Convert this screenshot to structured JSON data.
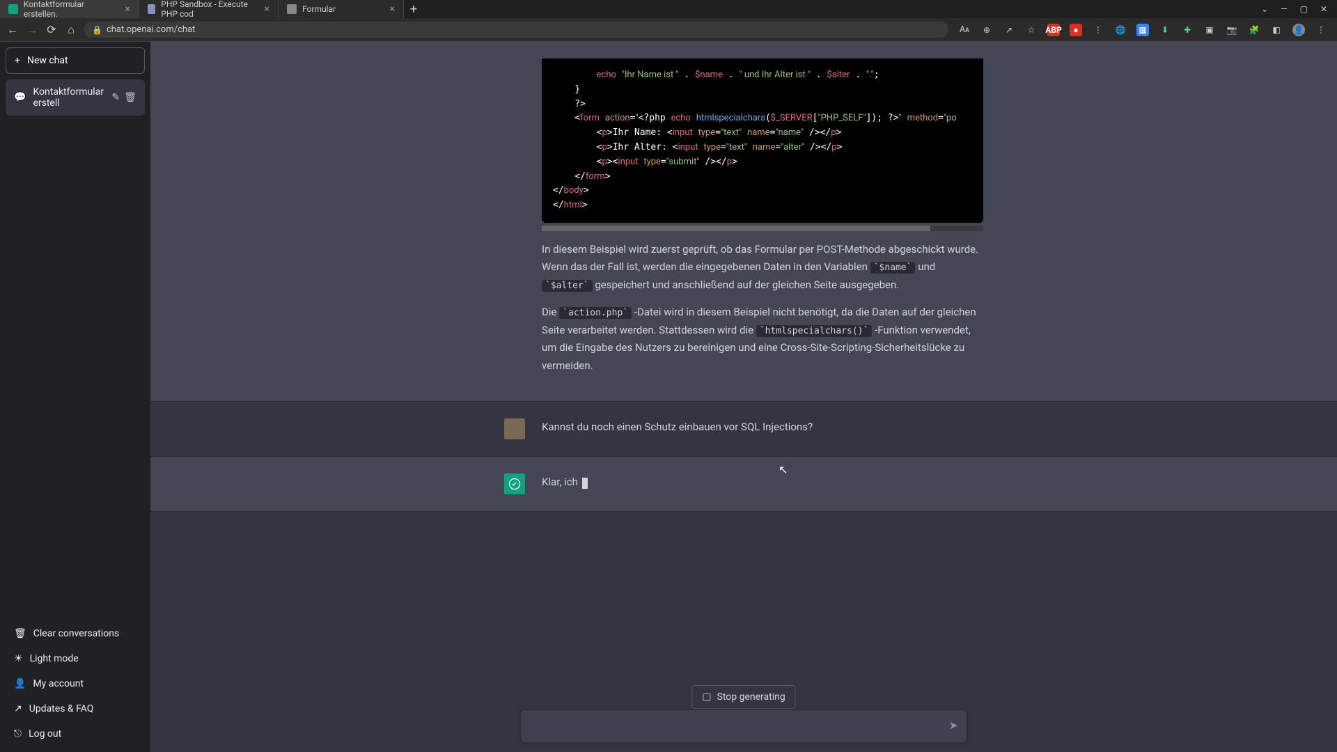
{
  "browser": {
    "tabs": [
      {
        "title": "Kontaktformular erstellen.",
        "active": true,
        "favicon_color": "#10a37f"
      },
      {
        "title": "PHP Sandbox - Execute PHP cod",
        "active": false,
        "favicon_color": "#8892bf"
      },
      {
        "title": "Formular",
        "active": false,
        "favicon_color": "#888"
      }
    ],
    "url": "chat.openai.com/chat",
    "window_controls": {
      "chevron": "⌄",
      "min": "—",
      "max": "▢",
      "close": "✕"
    }
  },
  "sidebar": {
    "new_chat_label": "New chat",
    "conversations": [
      {
        "title": "Kontaktformular erstell"
      }
    ],
    "bottom_items": [
      {
        "icon": "trash",
        "label": "Clear conversations"
      },
      {
        "icon": "sun",
        "label": "Light mode"
      },
      {
        "icon": "user",
        "label": "My account"
      },
      {
        "icon": "link",
        "label": "Updates & FAQ"
      },
      {
        "icon": "logout",
        "label": "Log out"
      }
    ]
  },
  "chat": {
    "assistant_code": {
      "lines_html": "        <span class='t-key'>echo</span> <span class='t-str'>\"Ihr Name ist \"</span> . <span class='t-var'>$name</span> . <span class='t-str'>\" und Ihr Alter ist \"</span> . <span class='t-var'>$alter</span> . <span class='t-str'>\".\"</span>;\n    }\n    ?&gt;\n    &lt;<span class='t-key'>form</span> <span class='t-attr'>action</span>=<span class='t-str'>\"</span>&lt;?php <span class='t-key'>echo</span> <span class='t-fn'>htmlspecialchars</span>(<span class='t-var'>$_SERVER</span>[<span class='t-str'>\"PHP_SELF\"</span>]); ?&gt;<span class='t-str'>\"</span> <span class='t-attr'>method</span>=<span class='t-str'>\"po</span>\n        &lt;<span class='t-key'>p</span>&gt;Ihr Name: &lt;<span class='t-key'>input</span> <span class='t-attr'>type</span>=<span class='t-type'>\"text\"</span> <span class='t-attr'>name</span>=<span class='t-type'>\"name\"</span> /&gt;&lt;/<span class='t-key'>p</span>&gt;\n        &lt;<span class='t-key'>p</span>&gt;Ihr Alter: &lt;<span class='t-key'>input</span> <span class='t-attr'>type</span>=<span class='t-type'>\"text\"</span> <span class='t-attr'>name</span>=<span class='t-type'>\"alter\"</span> /&gt;&lt;/<span class='t-key'>p</span>&gt;\n        &lt;<span class='t-key'>p</span>&gt;&lt;<span class='t-key'>input</span> <span class='t-attr'>type</span>=<span class='t-type'>\"submit\"</span> /&gt;&lt;/<span class='t-key'>p</span>&gt;\n    &lt;/<span class='t-key'>form</span>&gt;\n&lt;/<span class='t-key'>body</span>&gt;\n&lt;/<span class='t-key'>html</span>&gt;"
    },
    "assistant_text": {
      "p1_a": "In diesem Beispiel wird zuerst geprüft, ob das Formular per POST-Methode abgeschickt wurde. Wenn das der Fall ist, werden die eingegebenen Daten in den Variablen ",
      "p1_code1": "`$name`",
      "p1_b": " und ",
      "p1_code2": "`$alter`",
      "p1_c": " gespeichert und anschließend auf der gleichen Seite ausgegeben.",
      "p2_a": "Die ",
      "p2_code1": "`action.php`",
      "p2_b": "-Datei wird in diesem Beispiel nicht benötigt, da die Daten auf der gleichen Seite verarbeitet werden. Stattdessen wird die ",
      "p2_code2": "`htmlspecialchars()`",
      "p2_c": "-Funktion verwendet, um die Eingabe des Nutzers zu bereinigen und eine Cross-Site-Scripting-Sicherheitslücke zu vermeiden."
    },
    "user_msg": "Kannst du noch einen Schutz einbauen vor SQL Injections?",
    "assistant_reply_partial": "Klar, ich ",
    "stop_label": "Stop generating",
    "input_placeholder": ""
  }
}
